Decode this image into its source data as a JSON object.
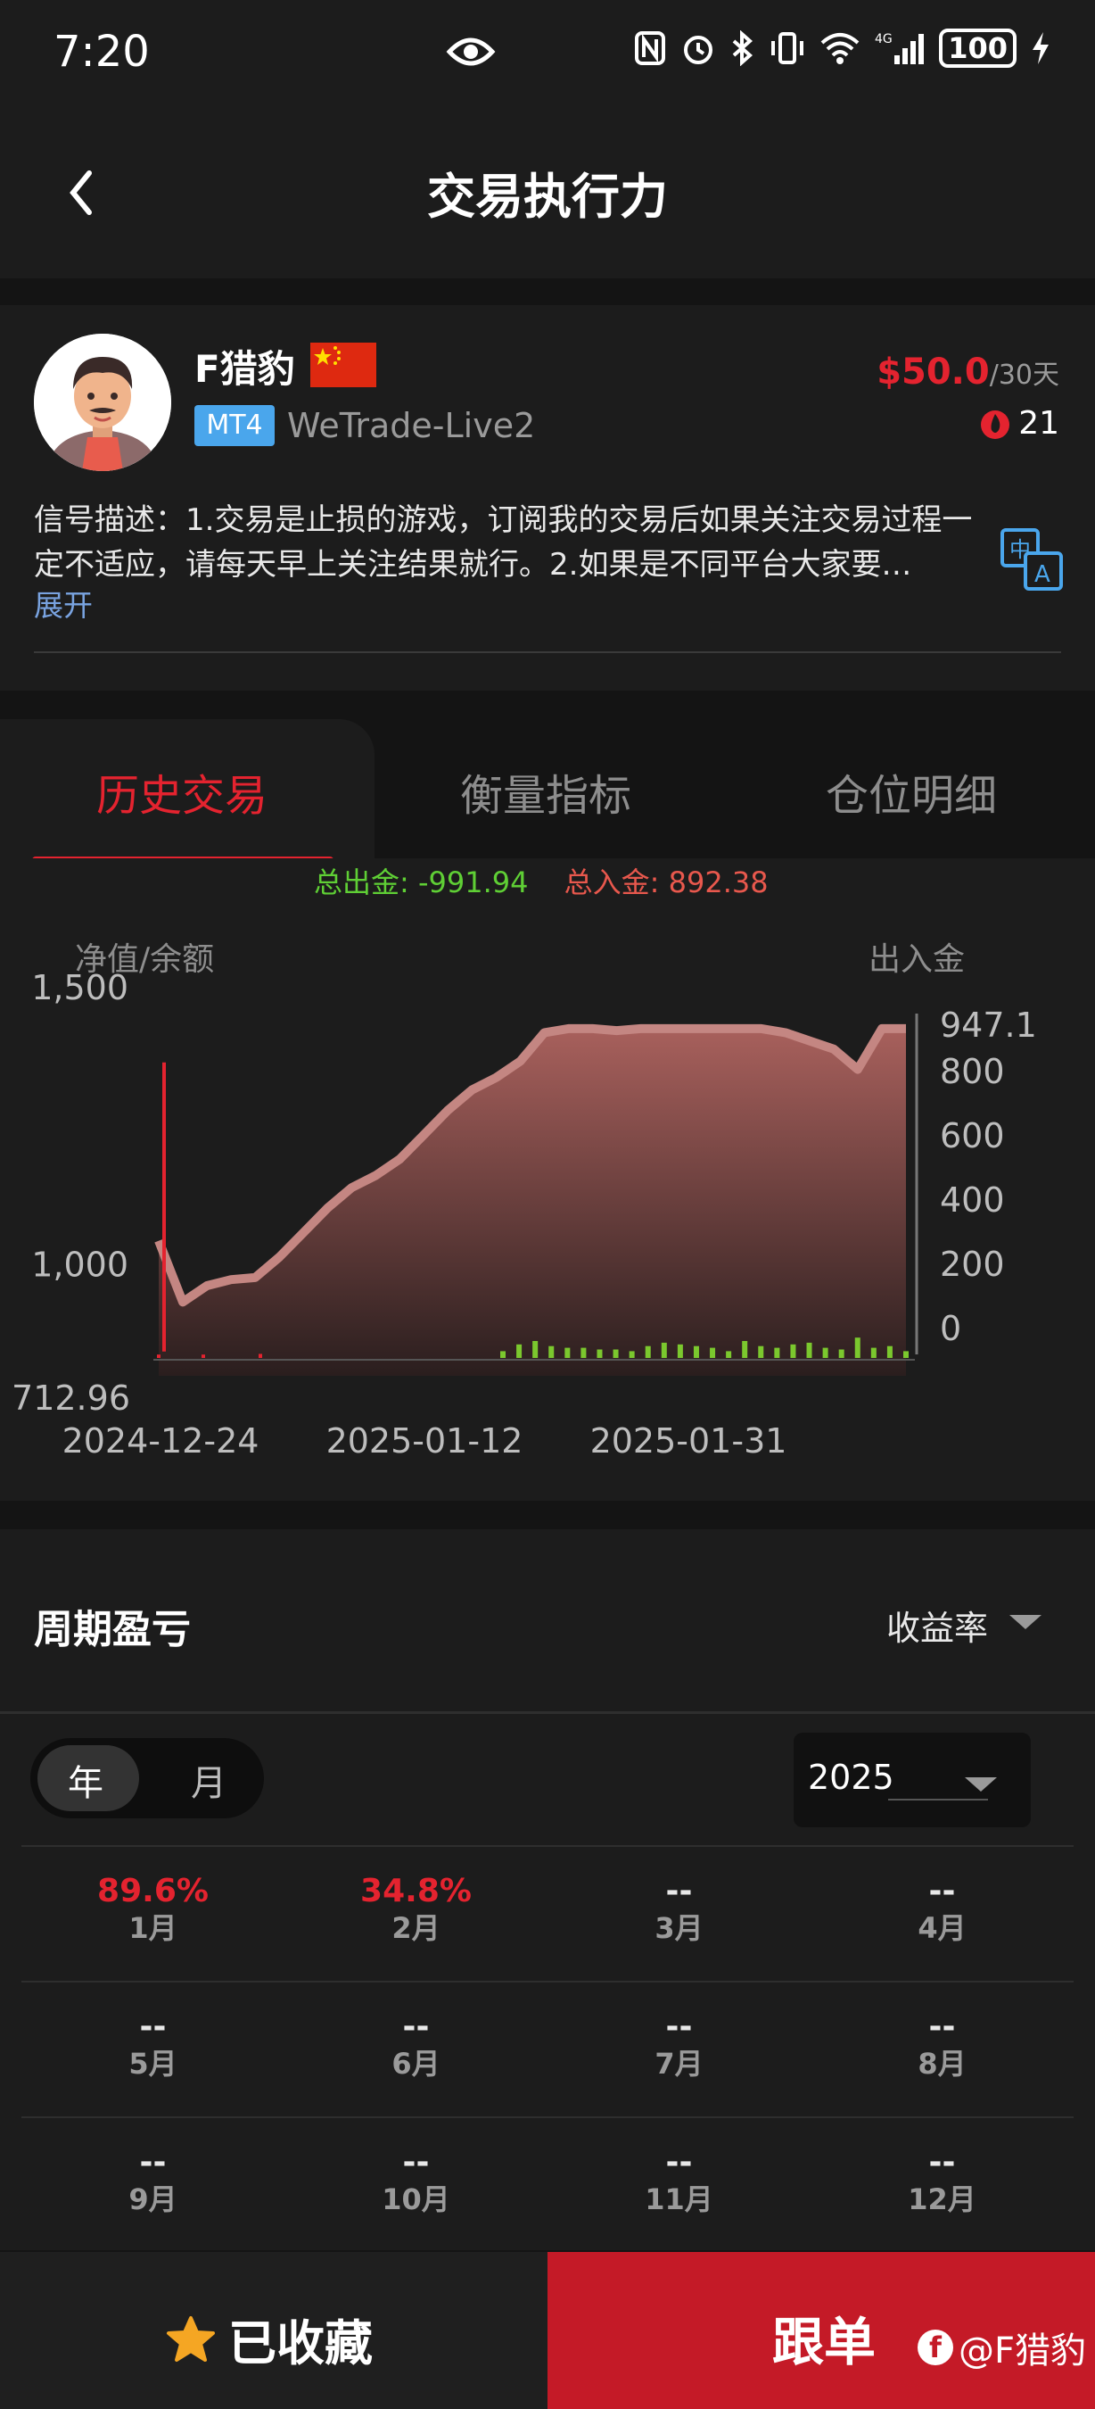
{
  "status": {
    "time": "7:20",
    "battery": "100"
  },
  "header": {
    "title": "交易执行力"
  },
  "profile": {
    "name": "F猎豹",
    "platform": "MT4",
    "server": "WeTrade-Live2",
    "price": "$50.0",
    "period": "/30天",
    "hot_count": "21",
    "description": "信号描述：1.交易是止损的游戏，订阅我的交易后如果关注交易过程一定不适应，请每天早上关注结果就行。2.如果是不同平台大家要…",
    "expand": "展开"
  },
  "tabs": [
    {
      "label": "历史交易",
      "active": true
    },
    {
      "label": "衡量指标",
      "active": false
    },
    {
      "label": "仓位明细",
      "active": false
    }
  ],
  "chart": {
    "total_out": "总出金: -991.94",
    "total_in": "总入金: 892.38",
    "left_axis_label": "净值/余额",
    "right_axis_label": "出入金"
  },
  "chart_data": {
    "type": "area",
    "left_y_ticks": [
      "1,500",
      "1,000",
      "712.96"
    ],
    "right_y_ticks": [
      "947.1",
      "800",
      "600",
      "400",
      "200",
      "0"
    ],
    "x_ticks": [
      "2024-12-24",
      "2025-01-12",
      "2025-01-31"
    ],
    "left_ylim": [
      712.96,
      1500
    ],
    "right_ylim": [
      0,
      947.1
    ],
    "series": [
      {
        "y": [
          1000,
          850,
          890,
          905,
          910,
          960,
          1020,
          1080,
          1130,
          1160,
          1200,
          1260,
          1320,
          1370,
          1400,
          1440,
          1510,
          1520,
          1520,
          1515,
          1520,
          1520,
          1520,
          1520,
          1520,
          1520,
          1510,
          1490,
          1470,
          1420,
          1520,
          1520
        ]
      },
      {
        "y": [
          130,
          1380
        ]
      },
      {
        "y": [
          20,
          40,
          50,
          35,
          30,
          30,
          25,
          25,
          20,
          35,
          45,
          40,
          35,
          30,
          20,
          50,
          35,
          30,
          40,
          45,
          30,
          25,
          60,
          30,
          35,
          20
        ]
      },
      {
        "y": [
          10,
          12,
          10
        ]
      }
    ]
  },
  "pnl": {
    "title": "周期盈亏",
    "metric": "收益率",
    "seg_year": "年",
    "seg_month": "月",
    "year": "2025",
    "months": [
      {
        "label": "1月",
        "value": "89.6%",
        "positive": true
      },
      {
        "label": "2月",
        "value": "34.8%",
        "positive": true
      },
      {
        "label": "3月",
        "value": "--",
        "positive": false
      },
      {
        "label": "4月",
        "value": "--",
        "positive": false
      },
      {
        "label": "5月",
        "value": "--",
        "positive": false
      },
      {
        "label": "6月",
        "value": "--",
        "positive": false
      },
      {
        "label": "7月",
        "value": "--",
        "positive": false
      },
      {
        "label": "8月",
        "value": "--",
        "positive": false
      },
      {
        "label": "9月",
        "value": "--",
        "positive": false
      },
      {
        "label": "10月",
        "value": "--",
        "positive": false
      },
      {
        "label": "11月",
        "value": "--",
        "positive": false
      },
      {
        "label": "12月",
        "value": "--",
        "positive": false
      }
    ]
  },
  "bottom": {
    "favorite": "已收藏",
    "follow": "跟单",
    "watermark": "@F猎豹"
  }
}
